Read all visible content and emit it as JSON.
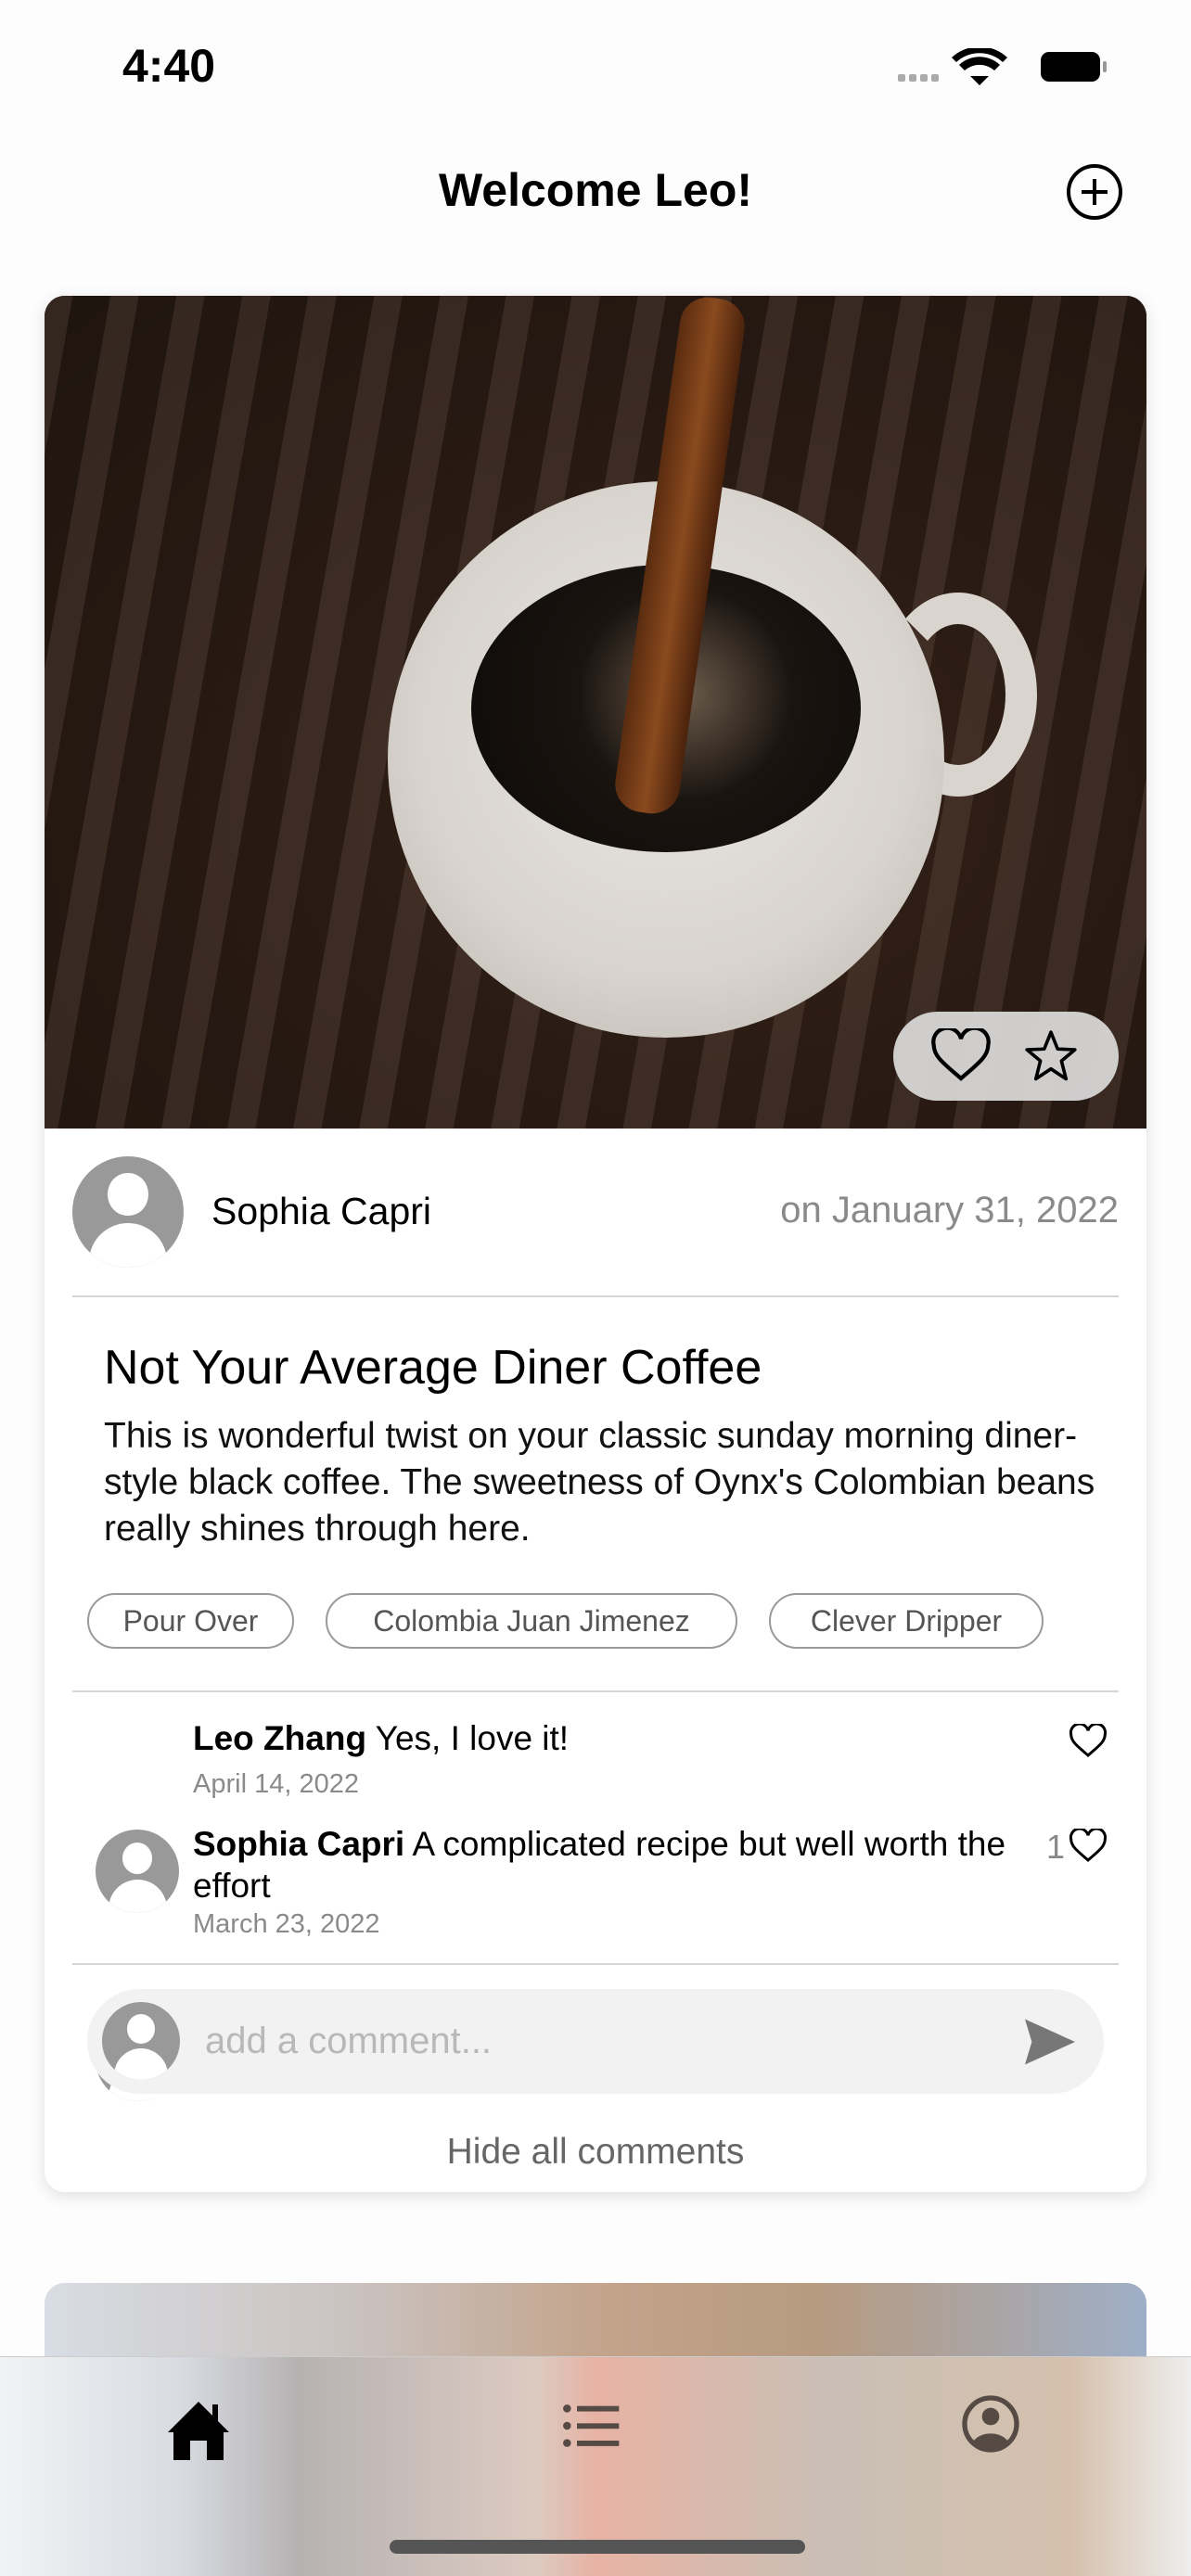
{
  "status_bar": {
    "time": "4:40"
  },
  "header": {
    "title": "Welcome Leo!",
    "add_icon": "plus-circle-icon"
  },
  "post": {
    "author": "Sophia Capri",
    "date": "on January 31, 2022",
    "title": "Not Your Average Diner Coffee",
    "description": "This is wonderful twist on your classic sunday morning diner-style black coffee. The sweetness of Oynx's Colombian beans really shines through here.",
    "tags": [
      "Pour Over",
      "Colombia Juan Jimenez",
      "Clever Dripper"
    ],
    "comments": [
      {
        "author": "Leo Zhang",
        "text": "Yes, I love it!",
        "date": "April 14, 2022",
        "likes": ""
      },
      {
        "author": "Sophia Capri",
        "text": "A complicated recipe but well worth the effort",
        "date": "March 23, 2022",
        "likes": "1"
      }
    ],
    "comment_placeholder": "add a comment...",
    "hide_comments": "Hide all comments"
  },
  "tabbar": {
    "items": [
      {
        "icon": "home-icon",
        "active": true
      },
      {
        "icon": "list-icon",
        "active": false
      },
      {
        "icon": "profile-icon",
        "active": false
      }
    ]
  }
}
